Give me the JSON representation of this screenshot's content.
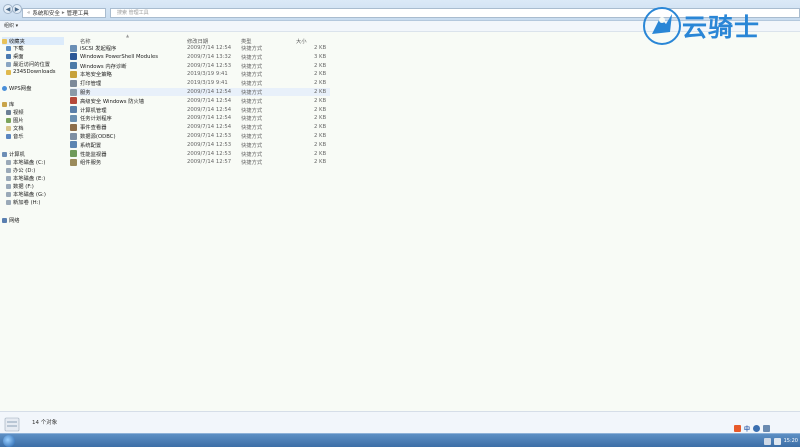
{
  "address": {
    "segments": [
      "系统和安全",
      "管理工具"
    ],
    "search_placeholder": "搜索 管理工具"
  },
  "toolbar": {
    "organize_label": "组织 ▾"
  },
  "sidebar": {
    "favorites": [
      "收藏夹",
      "下载",
      "桌面",
      "最近访问的位置",
      "2345Downloads"
    ],
    "wps": "WPS网盘",
    "libraries": [
      "库",
      "视频",
      "图片",
      "文档",
      "音乐"
    ],
    "computer": [
      "计算机",
      "本地磁盘 (C:)",
      "办公 (D:)",
      "本地磁盘 (E:)",
      "数据 (F:)",
      "本地磁盘 (G:)",
      "新加卷 (H:)"
    ],
    "network": "网络"
  },
  "columns": {
    "name": "名称",
    "date": "修改日期",
    "type": "类型",
    "size": "大小"
  },
  "files": [
    {
      "name": "iSCSI 发起程序",
      "date": "2009/7/14 12:54",
      "type": "快捷方式",
      "size": "2 KB",
      "icon": "iscsi-icon",
      "color": "#6b8fb5"
    },
    {
      "name": "Windows PowerShell Modules",
      "date": "2009/7/14 13:32",
      "type": "快捷方式",
      "size": "3 KB",
      "icon": "powershell-icon",
      "color": "#2b5797"
    },
    {
      "name": "Windows 内存诊断",
      "date": "2009/7/14 12:53",
      "type": "快捷方式",
      "size": "2 KB",
      "icon": "memory-diagnostic-icon",
      "color": "#4d7ba8"
    },
    {
      "name": "本地安全策略",
      "date": "2019/3/19 9:41",
      "type": "快捷方式",
      "size": "2 KB",
      "icon": "security-policy-icon",
      "color": "#c7a23a"
    },
    {
      "name": "打印管理",
      "date": "2019/3/19 9:41",
      "type": "快捷方式",
      "size": "2 KB",
      "icon": "print-management-icon",
      "color": "#7c8a99"
    },
    {
      "name": "服务",
      "date": "2009/7/14 12:54",
      "type": "快捷方式",
      "size": "2 KB",
      "icon": "services-icon",
      "color": "#8a9aa8"
    },
    {
      "name": "高级安全 Windows 防火墙",
      "date": "2009/7/14 12:54",
      "type": "快捷方式",
      "size": "2 KB",
      "icon": "firewall-icon",
      "color": "#b5493a"
    },
    {
      "name": "计算机管理",
      "date": "2009/7/14 12:54",
      "type": "快捷方式",
      "size": "2 KB",
      "icon": "computer-management-icon",
      "color": "#5a7fa8"
    },
    {
      "name": "任务计划程序",
      "date": "2009/7/14 12:54",
      "type": "快捷方式",
      "size": "2 KB",
      "icon": "task-scheduler-icon",
      "color": "#6a8fb0"
    },
    {
      "name": "事件查看器",
      "date": "2009/7/14 12:54",
      "type": "快捷方式",
      "size": "2 KB",
      "icon": "event-viewer-icon",
      "color": "#8d6e4a"
    },
    {
      "name": "数据源(ODBC)",
      "date": "2009/7/14 12:53",
      "type": "快捷方式",
      "size": "2 KB",
      "icon": "odbc-icon",
      "color": "#7d8fa3"
    },
    {
      "name": "系统配置",
      "date": "2009/7/14 12:53",
      "type": "快捷方式",
      "size": "2 KB",
      "icon": "system-config-icon",
      "color": "#5b84b1"
    },
    {
      "name": "性能监视器",
      "date": "2009/7/14 12:53",
      "type": "快捷方式",
      "size": "2 KB",
      "icon": "performance-monitor-icon",
      "color": "#6f9a5a"
    },
    {
      "name": "组件服务",
      "date": "2009/7/14 12:57",
      "type": "快捷方式",
      "size": "2 KB",
      "icon": "component-services-icon",
      "color": "#9a8a5a"
    }
  ],
  "status": {
    "count_text": "14 个对象"
  },
  "watermark": {
    "text": "云骑士"
  },
  "tray": {
    "ime": "中",
    "time": "15:20"
  }
}
